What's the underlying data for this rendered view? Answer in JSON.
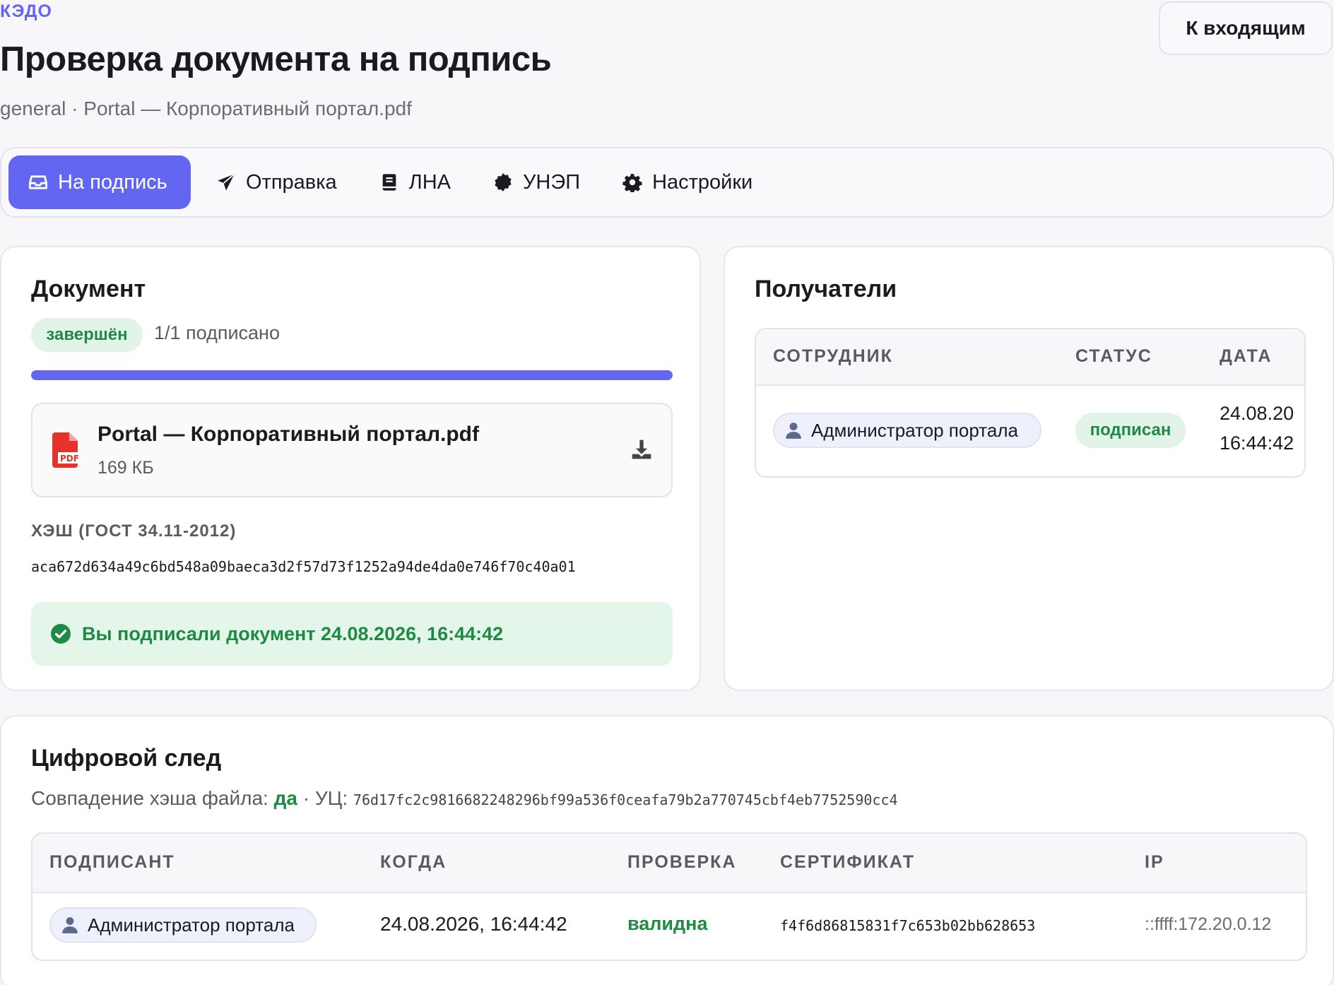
{
  "brand": "КЭДО",
  "back_button": "К входящим",
  "page": {
    "title": "Проверка документа на подпись",
    "subtitle": "general · Portal — Корпоративный портал.pdf"
  },
  "tabs": [
    {
      "label": "На подпись",
      "icon": "inbox-icon",
      "active": true
    },
    {
      "label": "Отправка",
      "icon": "send-icon"
    },
    {
      "label": "ЛНА",
      "icon": "book-icon"
    },
    {
      "label": "УНЭП",
      "icon": "badge-seal-icon"
    },
    {
      "label": "Настройки",
      "icon": "gear-icon"
    }
  ],
  "document": {
    "title": "Документ",
    "status": "завершён",
    "signed_count": "1/1 подписано",
    "progress": 1.0,
    "file": {
      "name": "Portal — Корпоративный портал.pdf",
      "size": "169 КБ",
      "icon": "pdf-file-icon"
    },
    "hash_label": "ХЭШ (ГОСТ 34.11-2012)",
    "hash_value": "aca672d634a49c6bd548a09baeca3d2f57d73f1252a94de4da0e746f70c40a01",
    "signed_message": "Вы подписали документ 24.08.2026, 16:44:42"
  },
  "recipients": {
    "title": "Получатели",
    "columns": [
      "СОТРУДНИК",
      "СТАТУС",
      "ДАТА"
    ],
    "rows": [
      {
        "employee": "Администратор портала",
        "status": "подписан",
        "date": "24.08.20",
        "time": "16:44:42"
      }
    ]
  },
  "trail": {
    "title": "Цифровой след",
    "hash_match_label": "Совпадение хэша файла:",
    "hash_match_value": "да",
    "ca_label": "· УЦ:",
    "ca_value": "76d17fc2c9816682248296bf99a536f0ceafa79b2a770745cbf4eb7752590cc4",
    "columns": [
      "ПОДПИСАНТ",
      "КОГДА",
      "ПРОВЕРКА",
      "СЕРТИФИКАТ",
      "IP"
    ],
    "rows": [
      {
        "signer": "Администратор портала",
        "when": "24.08.2026, 16:44:42",
        "check": "валидна",
        "cert": "f4f6d86815831f7c653b02bb628653",
        "ip": "::ffff:172.20.0.12"
      }
    ]
  },
  "colors": {
    "accent": "#6366f1",
    "success": "#1e8a44",
    "success_bg": "#e2f4e8",
    "pdf_red": "#e5322d"
  }
}
